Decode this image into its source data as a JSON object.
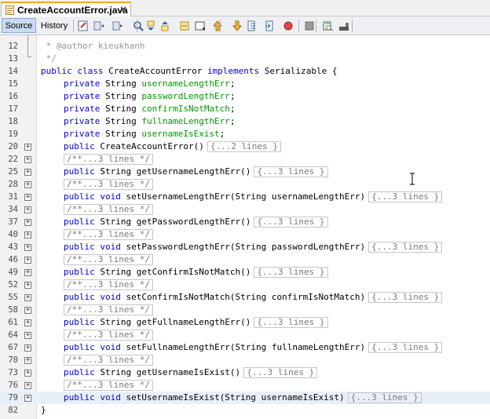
{
  "file_tab": {
    "name": "CreateAccountError.java",
    "close": "✕",
    "icon": "java-file-icon"
  },
  "toolbar": {
    "source_label": "Source",
    "history_label": "History",
    "icons": [
      "last-edit-icon",
      "back-icon",
      "forward-icon",
      "find-icon",
      "find-previous-icon",
      "find-next-icon",
      "toggle-highlight-icon",
      "toggle-bookmark-icon",
      "previous-bookmark-icon",
      "next-bookmark-icon",
      "shift-left-icon",
      "shift-right-icon",
      "start-macro-icon",
      "stop-macro-icon",
      "comment-icon",
      "uncomment-icon"
    ]
  },
  "lines": [
    {
      "n": "12",
      "tail": "",
      "comment": " * @author kieukhanh"
    },
    {
      "n": "13",
      "tail": "",
      "comment": " */"
    },
    {
      "n": "14",
      "kw1": "public class",
      "plain1": " CreateAccountError ",
      "kw2": "implements",
      "plain2": " Serializable {"
    },
    {
      "n": "15",
      "kw1": "private",
      "plain1": " String ",
      "field": "usernameLengthErr",
      "plain2": ";"
    },
    {
      "n": "16",
      "kw1": "private",
      "plain1": " String ",
      "field": "passwordLengthErr",
      "plain2": ";"
    },
    {
      "n": "17",
      "kw1": "private",
      "plain1": " String ",
      "field": "confirmIsNotMatch",
      "plain2": ";"
    },
    {
      "n": "18",
      "kw1": "private",
      "plain1": " String ",
      "field": "fullnameLengthErr",
      "plain2": ";"
    },
    {
      "n": "19",
      "kw1": "private",
      "plain1": " String ",
      "field": "usernameIsExist",
      "plain2": ";"
    },
    {
      "n": "20",
      "kw1": "public",
      "plain1": " CreateAccountError()",
      "fold": "{...2 lines }"
    },
    {
      "n": "22",
      "doc": "/**...3 lines */"
    },
    {
      "n": "25",
      "kw1": "public",
      "plain1": " String getUsernameLengthErr()",
      "fold": "{...3 lines }"
    },
    {
      "n": "28",
      "doc": "/**...3 lines */"
    },
    {
      "n": "31",
      "kw1": "public void",
      "plain1": " setUsernameLengthErr(String usernameLengthErr)",
      "fold": "{...3 lines }"
    },
    {
      "n": "34",
      "doc": "/**...3 lines */"
    },
    {
      "n": "37",
      "kw1": "public",
      "plain1": " String getPasswordLengthErr()",
      "fold": "{...3 lines }"
    },
    {
      "n": "40",
      "doc": "/**...3 lines */"
    },
    {
      "n": "43",
      "kw1": "public void",
      "plain1": " setPasswordLengthErr(String passwordLengthErr)",
      "fold": "{...3 lines }"
    },
    {
      "n": "46",
      "doc": "/**...3 lines */"
    },
    {
      "n": "49",
      "kw1": "public",
      "plain1": " String getConfirmIsNotMatch()",
      "fold": "{...3 lines }"
    },
    {
      "n": "52",
      "doc": "/**...3 lines */"
    },
    {
      "n": "55",
      "kw1": "public void",
      "plain1": " setConfirmIsNotMatch(String confirmIsNotMatch)",
      "fold": "{...3 lines }"
    },
    {
      "n": "58",
      "doc": "/**...3 lines */"
    },
    {
      "n": "61",
      "kw1": "public",
      "plain1": " String getFullnameLengthErr()",
      "fold": "{...3 lines }"
    },
    {
      "n": "64",
      "doc": "/**...3 lines */"
    },
    {
      "n": "67",
      "kw1": "public void",
      "plain1": " setFullnameLengthErr(String fullnameLengthErr)",
      "fold": "{...3 lines }"
    },
    {
      "n": "70",
      "doc": "/**...3 lines */"
    },
    {
      "n": "73",
      "kw1": "public",
      "plain1": " String getUsernameIsExist()",
      "fold": "{...3 lines }"
    },
    {
      "n": "76",
      "doc": "/**...3 lines */"
    },
    {
      "n": "79",
      "kw1": "public void",
      "plain1": " setUsernameIsExist(String usernameIsExist)",
      "fold": "{...3 lines }"
    },
    {
      "n": "82",
      "plain1": "}"
    }
  ]
}
